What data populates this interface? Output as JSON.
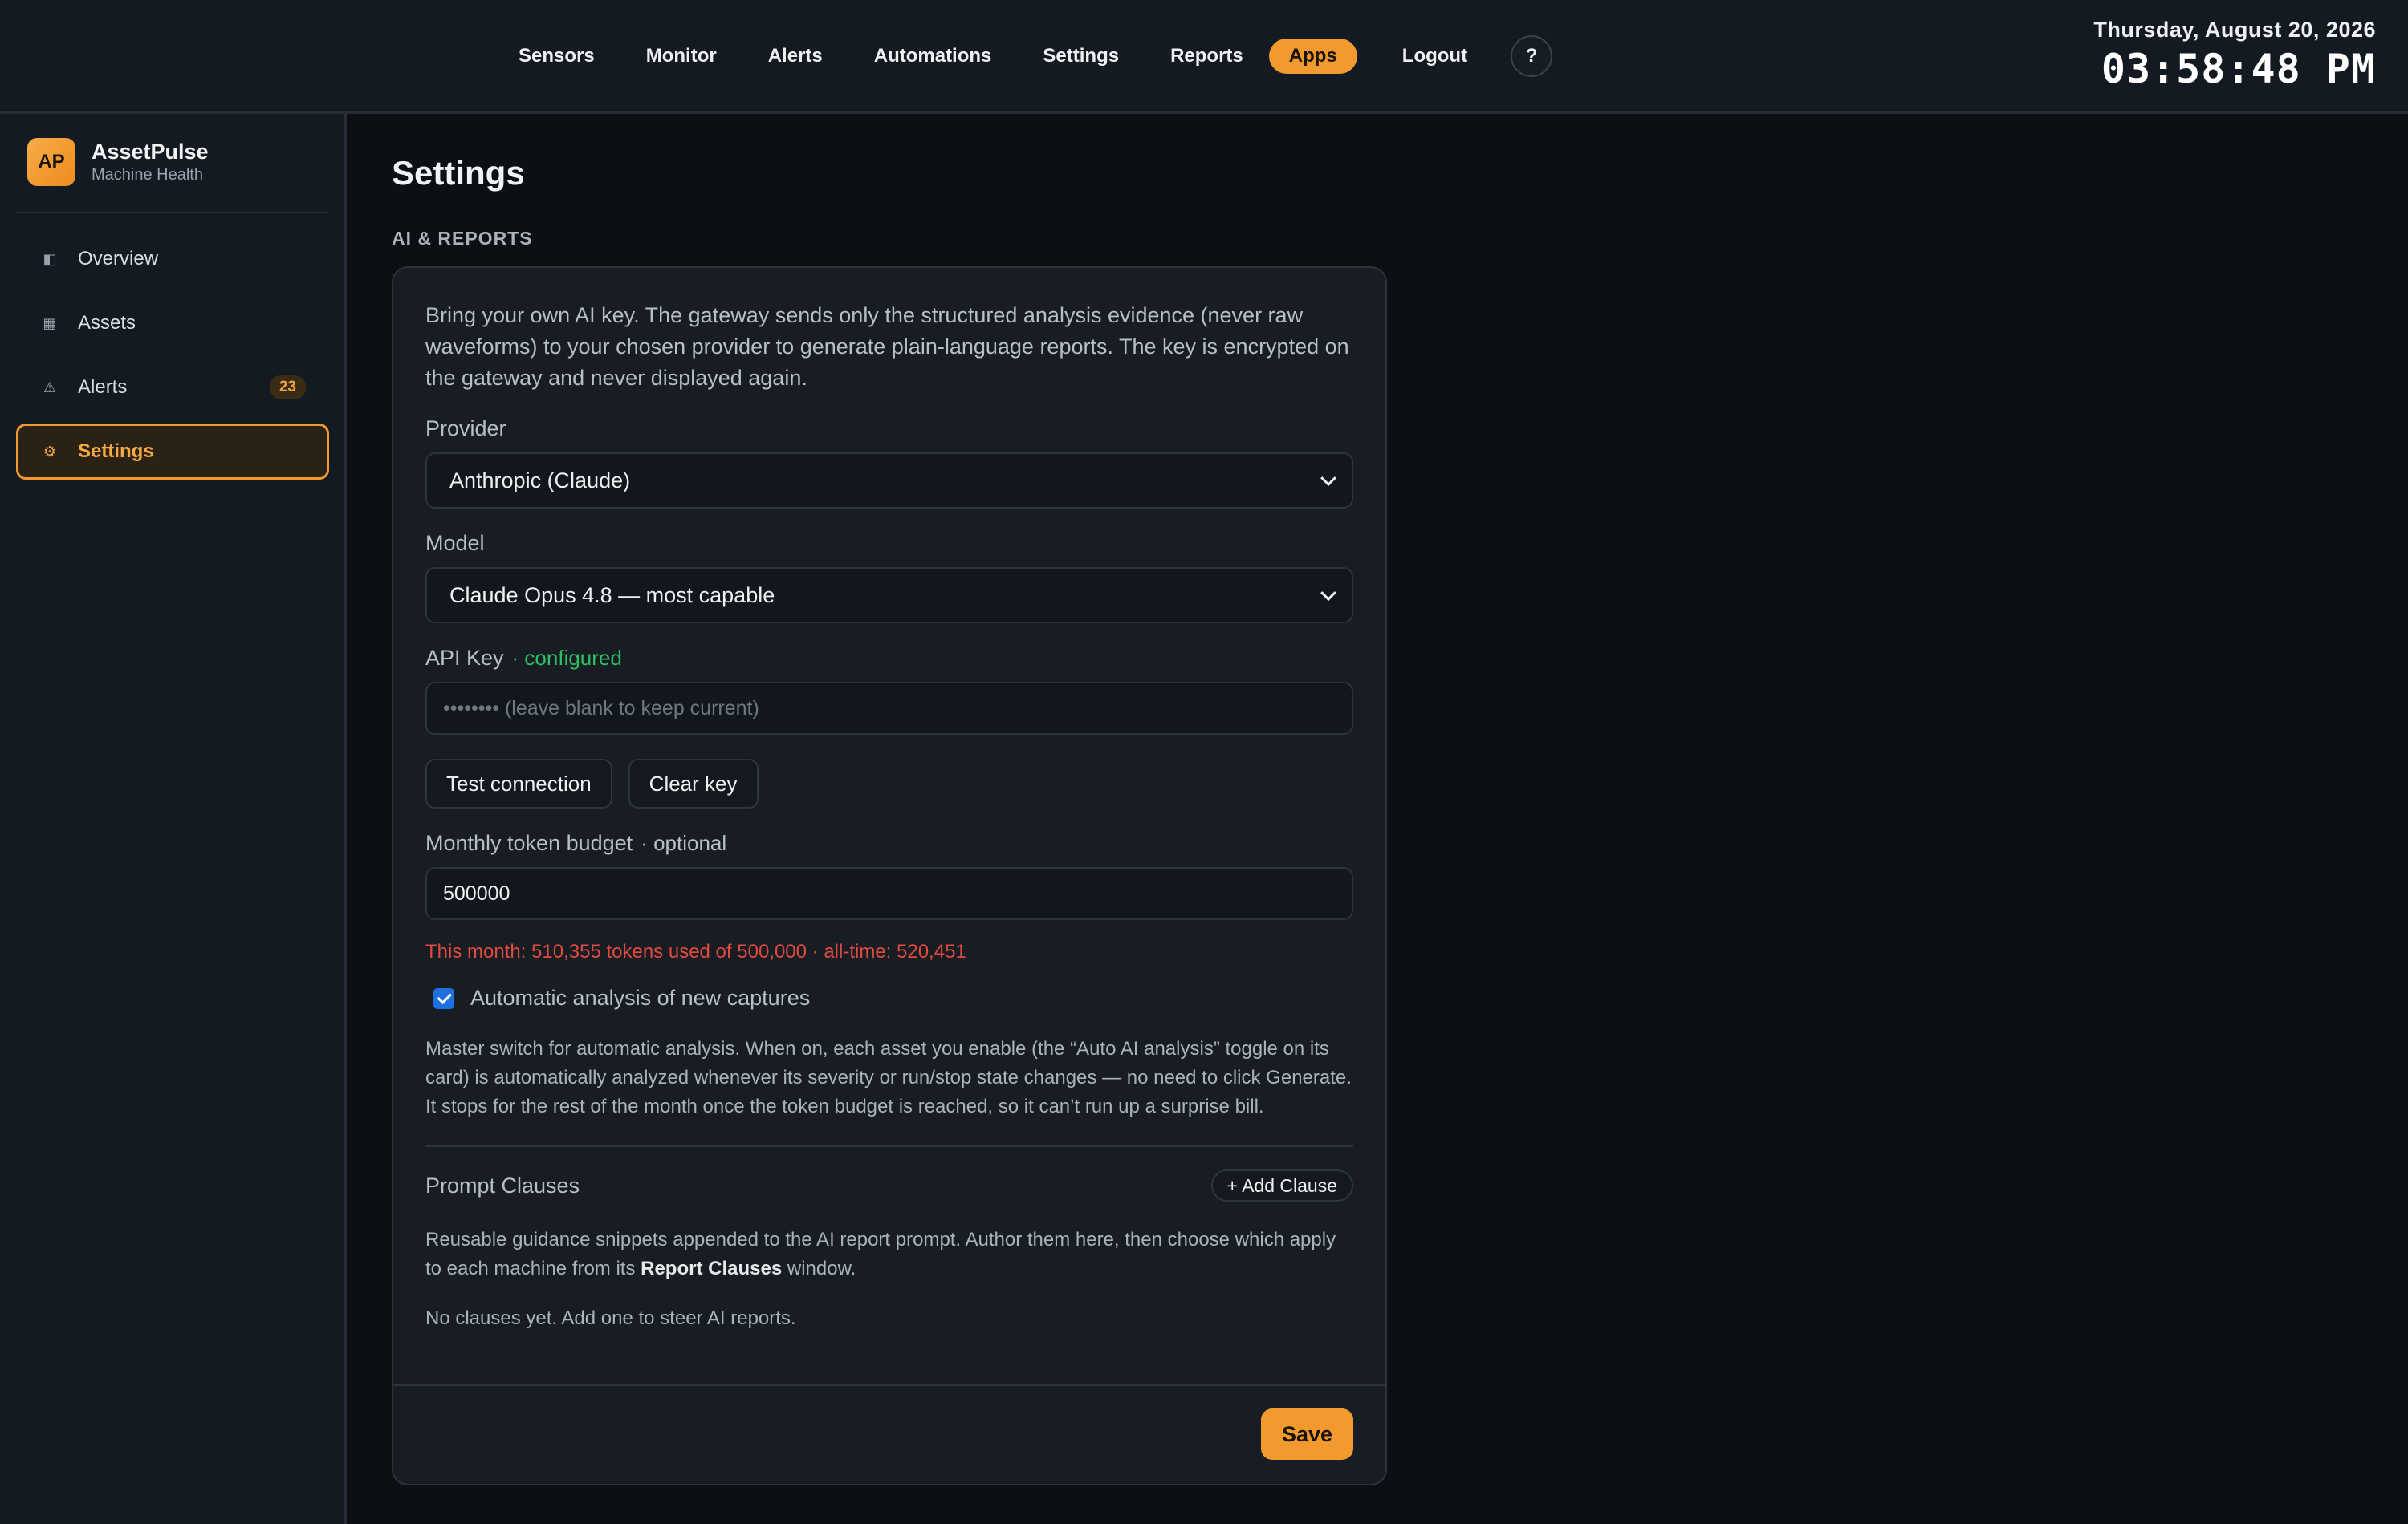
{
  "topnav": {
    "items": [
      "Sensors",
      "Monitor",
      "Alerts",
      "Automations",
      "Settings",
      "Reports",
      "Apps",
      "Logout"
    ],
    "active": "Apps",
    "help_label": "?"
  },
  "clock": {
    "date": "Thursday, August 20, 2026",
    "time": "03:58:48 PM"
  },
  "brand": {
    "logo": "AP",
    "name": "AssetPulse",
    "subtitle": "Machine Health"
  },
  "sidebar": {
    "items": [
      {
        "label": "Overview",
        "icon": "overview-icon",
        "glyph": "◧"
      },
      {
        "label": "Assets",
        "icon": "assets-icon",
        "glyph": "▦"
      },
      {
        "label": "Alerts",
        "icon": "alert-triangle-icon",
        "glyph": "⚠",
        "badge": "23"
      },
      {
        "label": "Settings",
        "icon": "gear-icon",
        "glyph": "⚙",
        "active": true
      }
    ]
  },
  "page": {
    "title": "Settings",
    "section": "AI & REPORTS"
  },
  "ai": {
    "intro": "Bring your own AI key. The gateway sends only the structured analysis evidence (never raw waveforms) to your chosen provider to generate plain-language reports. The key is encrypted on the gateway and never displayed again.",
    "provider_label": "Provider",
    "provider_value": "Anthropic (Claude)",
    "model_label": "Model",
    "model_value": "Claude Opus 4.8 — most capable",
    "api_key_label": "API Key",
    "api_key_status": "· configured",
    "api_key_placeholder": "•••••••• (leave blank to keep current)",
    "test_button": "Test connection",
    "clear_button": "Clear key",
    "budget_label": "Monthly token budget",
    "budget_optional": "· optional",
    "budget_value": "500000",
    "usage_text": "This month: 510,355 tokens used of 500,000 · all-time: 520,451",
    "auto_label": "Automatic analysis of new captures",
    "auto_checked": true,
    "auto_help": "Master switch for automatic analysis. When on, each asset you enable (the “Auto AI analysis” toggle on its card) is automatically analyzed whenever its severity or run/stop state changes — no need to click Generate. It stops for the rest of the month once the token budget is reached, so it can’t run up a surprise bill.",
    "clauses_title": "Prompt Clauses",
    "add_clause_button": "+ Add Clause",
    "clauses_desc_before": "Reusable guidance snippets appended to the AI report prompt. Author them here, then choose which apply to each machine from its ",
    "clauses_desc_bold": "Report Clauses",
    "clauses_desc_after": " window.",
    "no_clauses": "No clauses yet. Add one to steer AI reports.",
    "save_button": "Save"
  },
  "colors": {
    "accent": "#f39a2e",
    "success": "#2fbf63",
    "danger": "#e04a3f",
    "checkbox": "#1e6fe0"
  }
}
